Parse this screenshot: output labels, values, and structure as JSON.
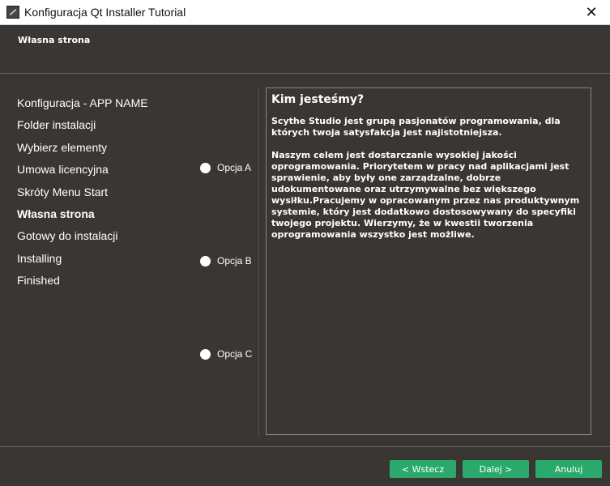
{
  "window": {
    "title": "Konfiguracja Qt Installer Tutorial",
    "close_glyph": "✕"
  },
  "header": {
    "page_title": "Własna strona"
  },
  "sidebar": {
    "items": [
      {
        "label": "Konfiguracja - APP NAME",
        "active": false
      },
      {
        "label": "Folder instalacji",
        "active": false
      },
      {
        "label": "Wybierz elementy",
        "active": false
      },
      {
        "label": "Umowa licencyjna",
        "active": false
      },
      {
        "label": "Skróty Menu Start",
        "active": false
      },
      {
        "label": "Własna strona",
        "active": true
      },
      {
        "label": "Gotowy do instalacji",
        "active": false
      },
      {
        "label": "Installing",
        "active": false
      },
      {
        "label": "Finished",
        "active": false
      }
    ]
  },
  "options": [
    {
      "label": "Opcja A"
    },
    {
      "label": "Opcja B"
    },
    {
      "label": "Opcja C"
    }
  ],
  "content": {
    "heading": "Kim jesteśmy?",
    "paragraph1": "Scythe Studio jest grupą pasjonatów programowania, dla których twoja satysfakcja jest najistotniejsza.",
    "paragraph2": "Naszym celem jest dostarczanie wysokiej jakości oprogramowania. Priorytetem w pracy nad aplikacjami jest sprawienie, aby były one zarządzalne, dobrze udokumentowane oraz utrzymywalne bez większego wysiłku.Pracujemy w opracowanym przez nas produktywnym systemie, który jest dodatkowo dostosowywany do specyfiki twojego projektu. Wierzymy, że w kwestii tworzenia oprogramowania wszystko jest możliwe."
  },
  "buttons": {
    "back": "< Wstecz",
    "next": "Dalej >",
    "cancel": "Anuluj"
  },
  "colors": {
    "background": "#3a3634",
    "accent": "#2aa96b",
    "text": "#ffffff"
  }
}
